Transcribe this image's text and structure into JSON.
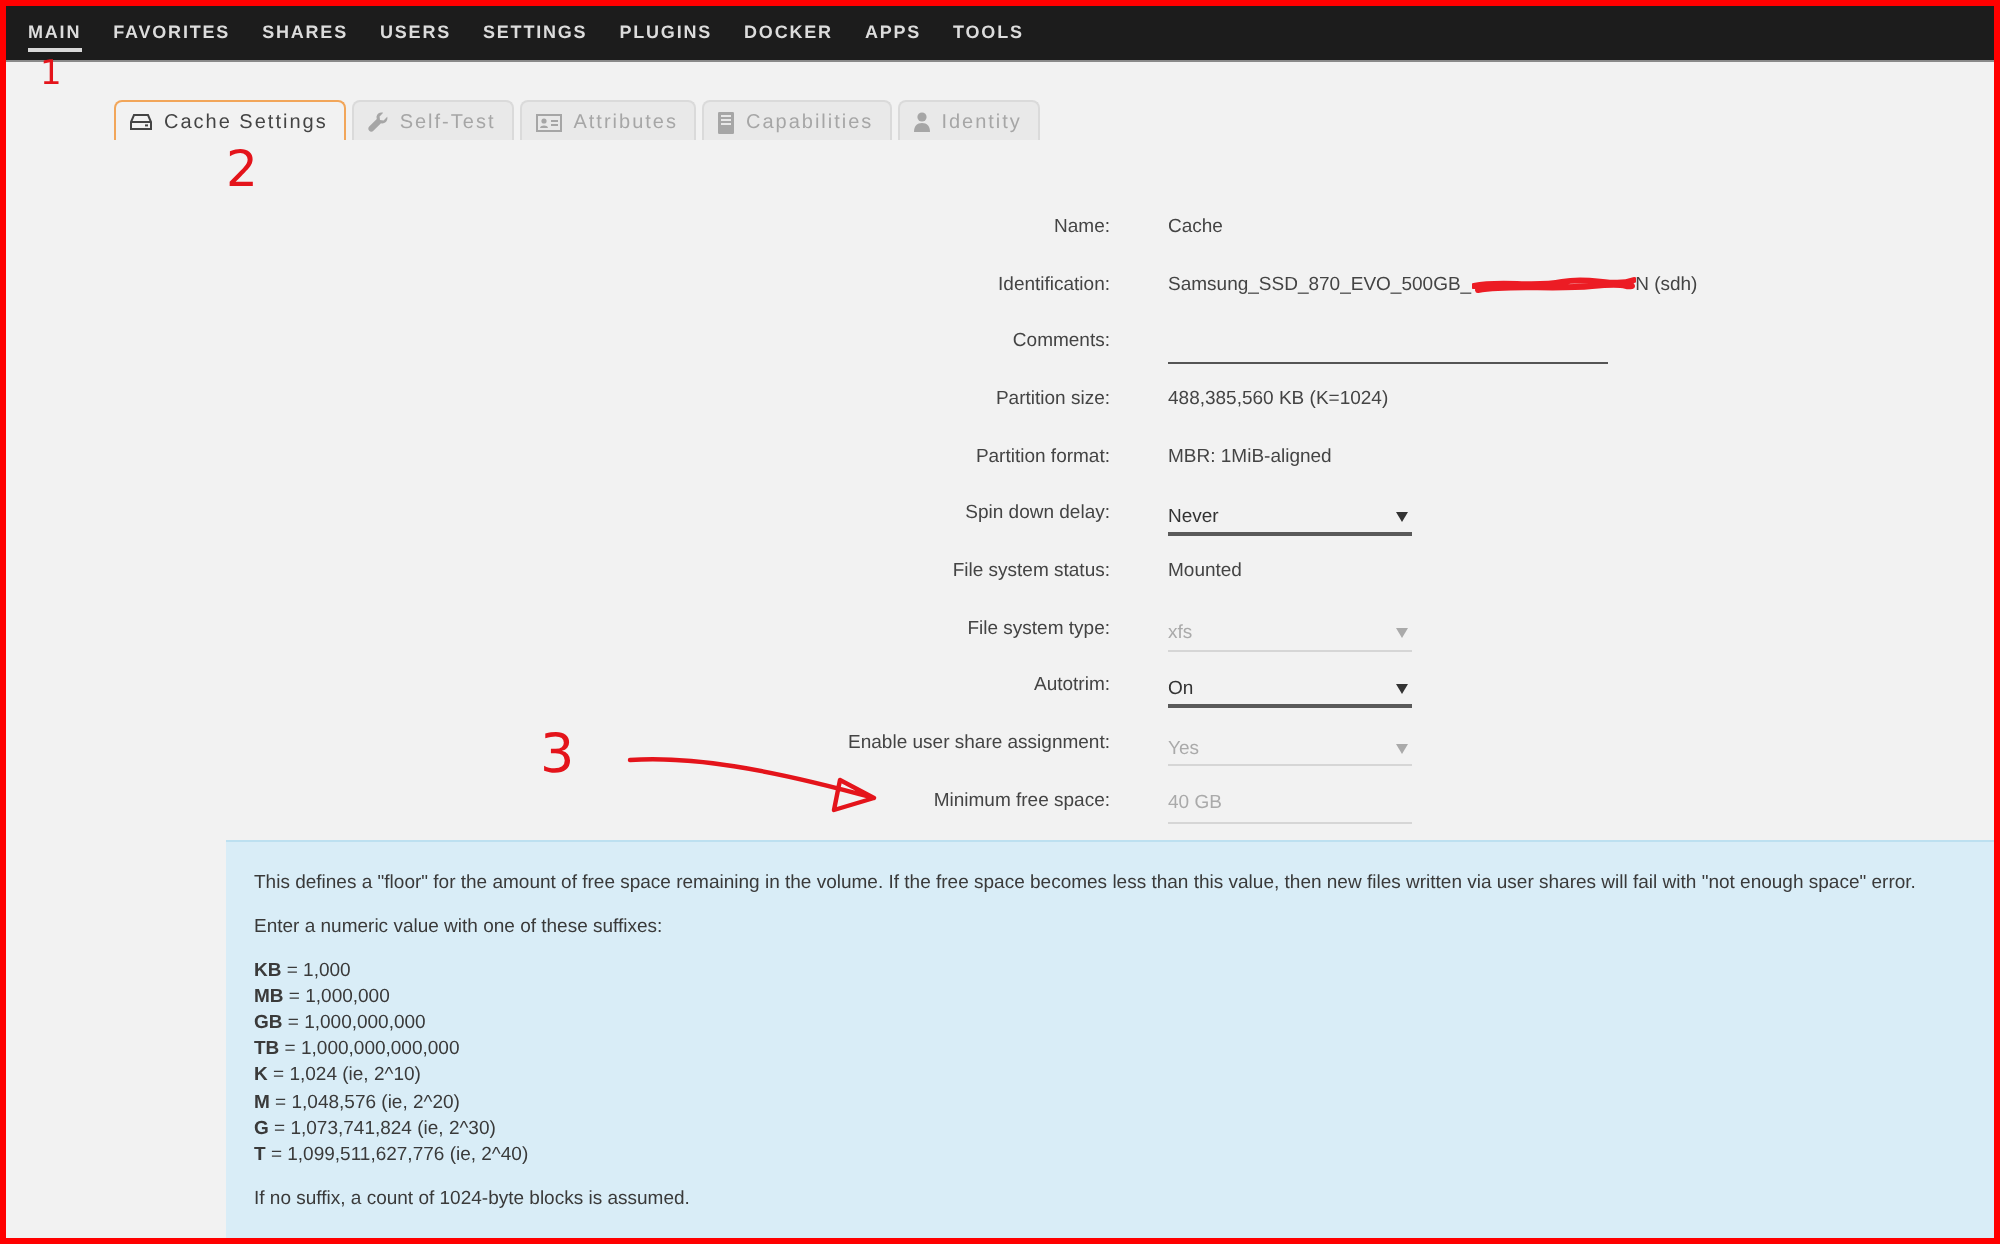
{
  "annotation_frame": true,
  "nav": {
    "items": [
      {
        "label": "MAIN",
        "selected": true,
        "annotation": "1"
      },
      {
        "label": "FAVORITES",
        "selected": false
      },
      {
        "label": "SHARES",
        "selected": false
      },
      {
        "label": "USERS",
        "selected": false
      },
      {
        "label": "SETTINGS",
        "selected": false
      },
      {
        "label": "PLUGINS",
        "selected": false
      },
      {
        "label": "DOCKER",
        "selected": false
      },
      {
        "label": "APPS",
        "selected": false
      },
      {
        "label": "TOOLS",
        "selected": false
      }
    ]
  },
  "tabs": [
    {
      "label": "Cache Settings",
      "selected": true,
      "annotation": "2"
    },
    {
      "label": "Self-Test",
      "selected": false
    },
    {
      "label": "Attributes",
      "selected": false
    },
    {
      "label": "Capabilities",
      "selected": false
    },
    {
      "label": "Identity",
      "selected": false
    }
  ],
  "fields": [
    {
      "label": "Name:",
      "kind": "text",
      "value": "Cache"
    },
    {
      "label": "Identification:",
      "kind": "text",
      "value": "Samsung_SSD_870_EVO_500GB_",
      "redacted": true,
      "value_after": "N (sdh)"
    },
    {
      "label": "Comments:",
      "kind": "input",
      "disabled": false
    },
    {
      "label": "Partition size:",
      "kind": "text",
      "value": "488,385,560 KB (K=1024)"
    },
    {
      "label": "Partition format:",
      "kind": "text",
      "value": "MBR: 1MiB-aligned"
    },
    {
      "label": "Spin down delay:",
      "kind": "select",
      "value": "Never",
      "disabled": false
    },
    {
      "label": "File system status:",
      "kind": "text",
      "value": "Mounted"
    },
    {
      "label": "File system type:",
      "kind": "select",
      "value": "xfs",
      "disabled": true
    },
    {
      "label": "Autotrim:",
      "kind": "select",
      "value": "On",
      "disabled": false
    },
    {
      "label": "Enable user share assignment:",
      "kind": "select",
      "value": "Yes",
      "disabled": true
    },
    {
      "label": "Minimum free space:",
      "kind": "input",
      "value": "40 GB",
      "disabled": true,
      "annotation": "3",
      "annotation_arrow": true
    }
  ],
  "help": {
    "blocks": [
      {
        "kind": "paragraph",
        "text": "This defines a \"floor\" for the amount of free space remaining in the volume. If the free space becomes less than this value, then new files written via user shares will fail with \"not enough space\" error."
      },
      {
        "kind": "paragraph",
        "text": "Enter a numeric value with one of these suffixes:"
      },
      {
        "kind": "lines",
        "lines": [
          "**KB** = 1,000",
          "**MB** = 1,000,000",
          "**GB** = 1,000,000,000",
          "**TB** = 1,000,000,000,000",
          "**K** = 1,024 (ie, 2^10)",
          "**M** = 1,048,576 (ie, 2^20)",
          "**G** = 1,073,741,824 (ie, 2^30)",
          "**T** = 1,099,511,627,776 (ie, 2^40)"
        ]
      },
      {
        "kind": "paragraph",
        "text": "If no suffix, a count of 1024-byte blocks is assumed."
      }
    ]
  }
}
